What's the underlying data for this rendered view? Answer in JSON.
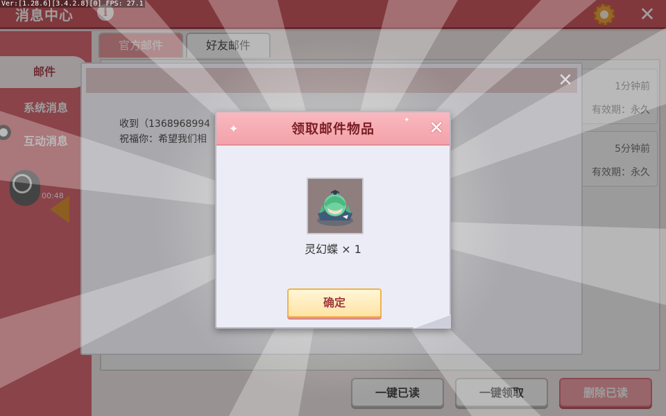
{
  "version": "Ver:[1.28.6][3.4.2.8][0] FPS: 27.1",
  "header": {
    "title": "消息中心",
    "info_icon": "info-icon",
    "settings_icon": "gear-icon",
    "close_icon": "close-icon"
  },
  "sidebar": {
    "items": [
      {
        "label": "邮件",
        "active": true
      },
      {
        "label": "系统消息",
        "active": false
      },
      {
        "label": "互动消息",
        "active": false
      }
    ]
  },
  "tabs": [
    {
      "label": "官方邮件",
      "active": false
    },
    {
      "label": "好友邮件",
      "active": true
    }
  ],
  "mail_list": [
    {
      "time": "1分钟前",
      "expire": "有效期：永久"
    },
    {
      "time": "5分钟前",
      "expire": "有效期：永久"
    }
  ],
  "bottom_buttons": {
    "mark_all_read": "一键已读",
    "claim_all": "一键领取",
    "delete_read": "删除已读"
  },
  "timer": "00:48",
  "mail_detail": {
    "line1": "收到（1368968994",
    "line2": "祝福你：希望我们相"
  },
  "reward_popup": {
    "title": "领取邮件物品",
    "item_name": "灵幻蝶 × 1",
    "confirm_label": "确定",
    "accent_color": "#f3a2aa"
  }
}
